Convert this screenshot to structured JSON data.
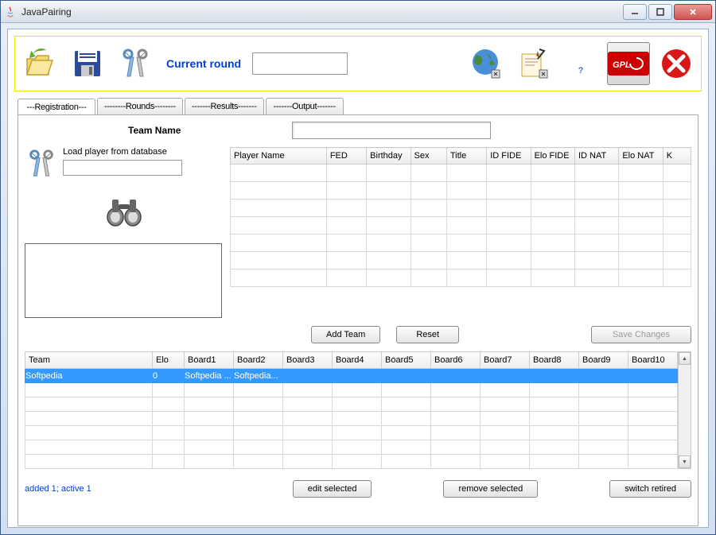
{
  "window": {
    "title": "JavaPairing"
  },
  "toolbar": {
    "current_round_label": "Current round",
    "current_round_value": "",
    "gpl_text": "GPLv3"
  },
  "tabs": [
    {
      "label": "---Registration---"
    },
    {
      "label": "--------Rounds--------"
    },
    {
      "label": "-------Results-------"
    },
    {
      "label": "-------Output-------"
    }
  ],
  "registration": {
    "team_name_label": "Team Name",
    "team_name_value": "",
    "load_player_label": "Load player from database",
    "load_player_value": "",
    "player_columns": [
      "Player Name",
      "FED",
      "Birthday",
      "Sex",
      "Title",
      "ID FIDE",
      "Elo FIDE",
      "ID NAT",
      "Elo NAT",
      "K"
    ],
    "buttons": {
      "add_team": "Add Team",
      "reset": "Reset",
      "save_changes": "Save Changes",
      "edit_selected": "edit selected",
      "remove_selected": "remove selected",
      "switch_retired": "switch retired"
    },
    "team_columns": [
      "Team",
      "Elo",
      "Board1",
      "Board2",
      "Board3",
      "Board4",
      "Board5",
      "Board6",
      "Board7",
      "Board8",
      "Board9",
      "Board10"
    ],
    "team_rows": [
      {
        "team": "Softpedia",
        "elo": "0",
        "b1": "Softpedia ...",
        "b2": "Softpedia...",
        "b3": "",
        "b4": "",
        "b5": "",
        "b6": "",
        "b7": "",
        "b8": "",
        "b9": "",
        "b10": ""
      }
    ],
    "status": "added 1; active 1"
  }
}
